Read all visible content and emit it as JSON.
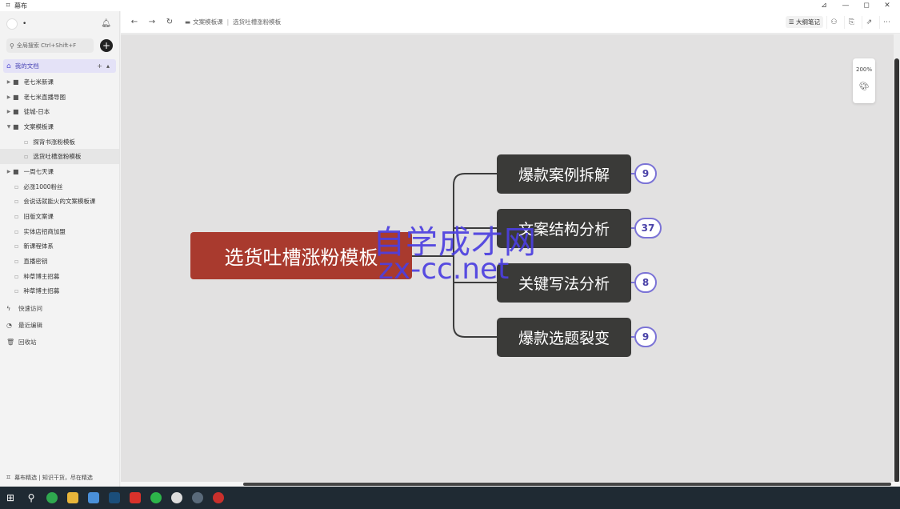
{
  "app": {
    "title": "幕布"
  },
  "window_controls": {
    "pin": "⊿",
    "minimize": "—",
    "maximize": "◻",
    "close": "✕"
  },
  "sidebar": {
    "username": "•",
    "search_placeholder": "全局搜索 Ctrl+Shift+F",
    "my_docs": "我的文档",
    "items": [
      {
        "label": "老七米新课",
        "type": "folder",
        "depth": 0
      },
      {
        "label": "老七米直播导图",
        "type": "folder",
        "depth": 0
      },
      {
        "label": "徒城-日本",
        "type": "folder",
        "depth": 0
      },
      {
        "label": "文案模板课",
        "type": "folder-open",
        "depth": 0
      },
      {
        "label": "探背书涨粉模板",
        "type": "doc",
        "depth": 1
      },
      {
        "label": "选货吐槽涨粉模板",
        "type": "doc",
        "depth": 1,
        "active": true
      },
      {
        "label": "一周七天课",
        "type": "folder",
        "depth": 0
      },
      {
        "label": "必涨1000粉丝",
        "type": "doc",
        "depth": 0
      },
      {
        "label": "会说话就能火的文案模板课",
        "type": "doc",
        "depth": 0
      },
      {
        "label": "旧版文案课",
        "type": "doc",
        "depth": 0
      },
      {
        "label": "实体店招商加盟",
        "type": "doc",
        "depth": 0
      },
      {
        "label": "新课程体系",
        "type": "doc",
        "depth": 0
      },
      {
        "label": "直播密钥",
        "type": "doc",
        "depth": 0
      },
      {
        "label": "种草博主招募",
        "type": "doc",
        "depth": 0
      },
      {
        "label": "种草博主招募",
        "type": "doc",
        "depth": 0
      }
    ],
    "nav": [
      {
        "label": "快速访问",
        "icon": "lightning-icon"
      },
      {
        "label": "最近编辑",
        "icon": "clock-icon"
      },
      {
        "label": "回收站",
        "icon": "trash-icon"
      }
    ],
    "footer": "幕布精选 | 知识干货，尽在精选"
  },
  "toolbar": {
    "breadcrumb": [
      "文案模板课",
      "选货吐槽涨粉模板"
    ],
    "outline_label": "大纲笔记"
  },
  "zoom": {
    "level": "200%"
  },
  "mindmap": {
    "root": "选货吐槽涨粉模板",
    "branches": [
      {
        "label": "爆款案例拆解",
        "count": "9"
      },
      {
        "label": "文案结构分析",
        "count": "37"
      },
      {
        "label": "关键写法分析",
        "count": "8"
      },
      {
        "label": "爆款选题裂变",
        "count": "9"
      }
    ]
  },
  "watermark": {
    "line1": "自学成才网",
    "line2": "zx-cc.net"
  },
  "colors": {
    "root": "#a93a2e",
    "branch": "#3a3a38",
    "badge_border": "#7b73d6",
    "accent": "#5b56d6"
  }
}
